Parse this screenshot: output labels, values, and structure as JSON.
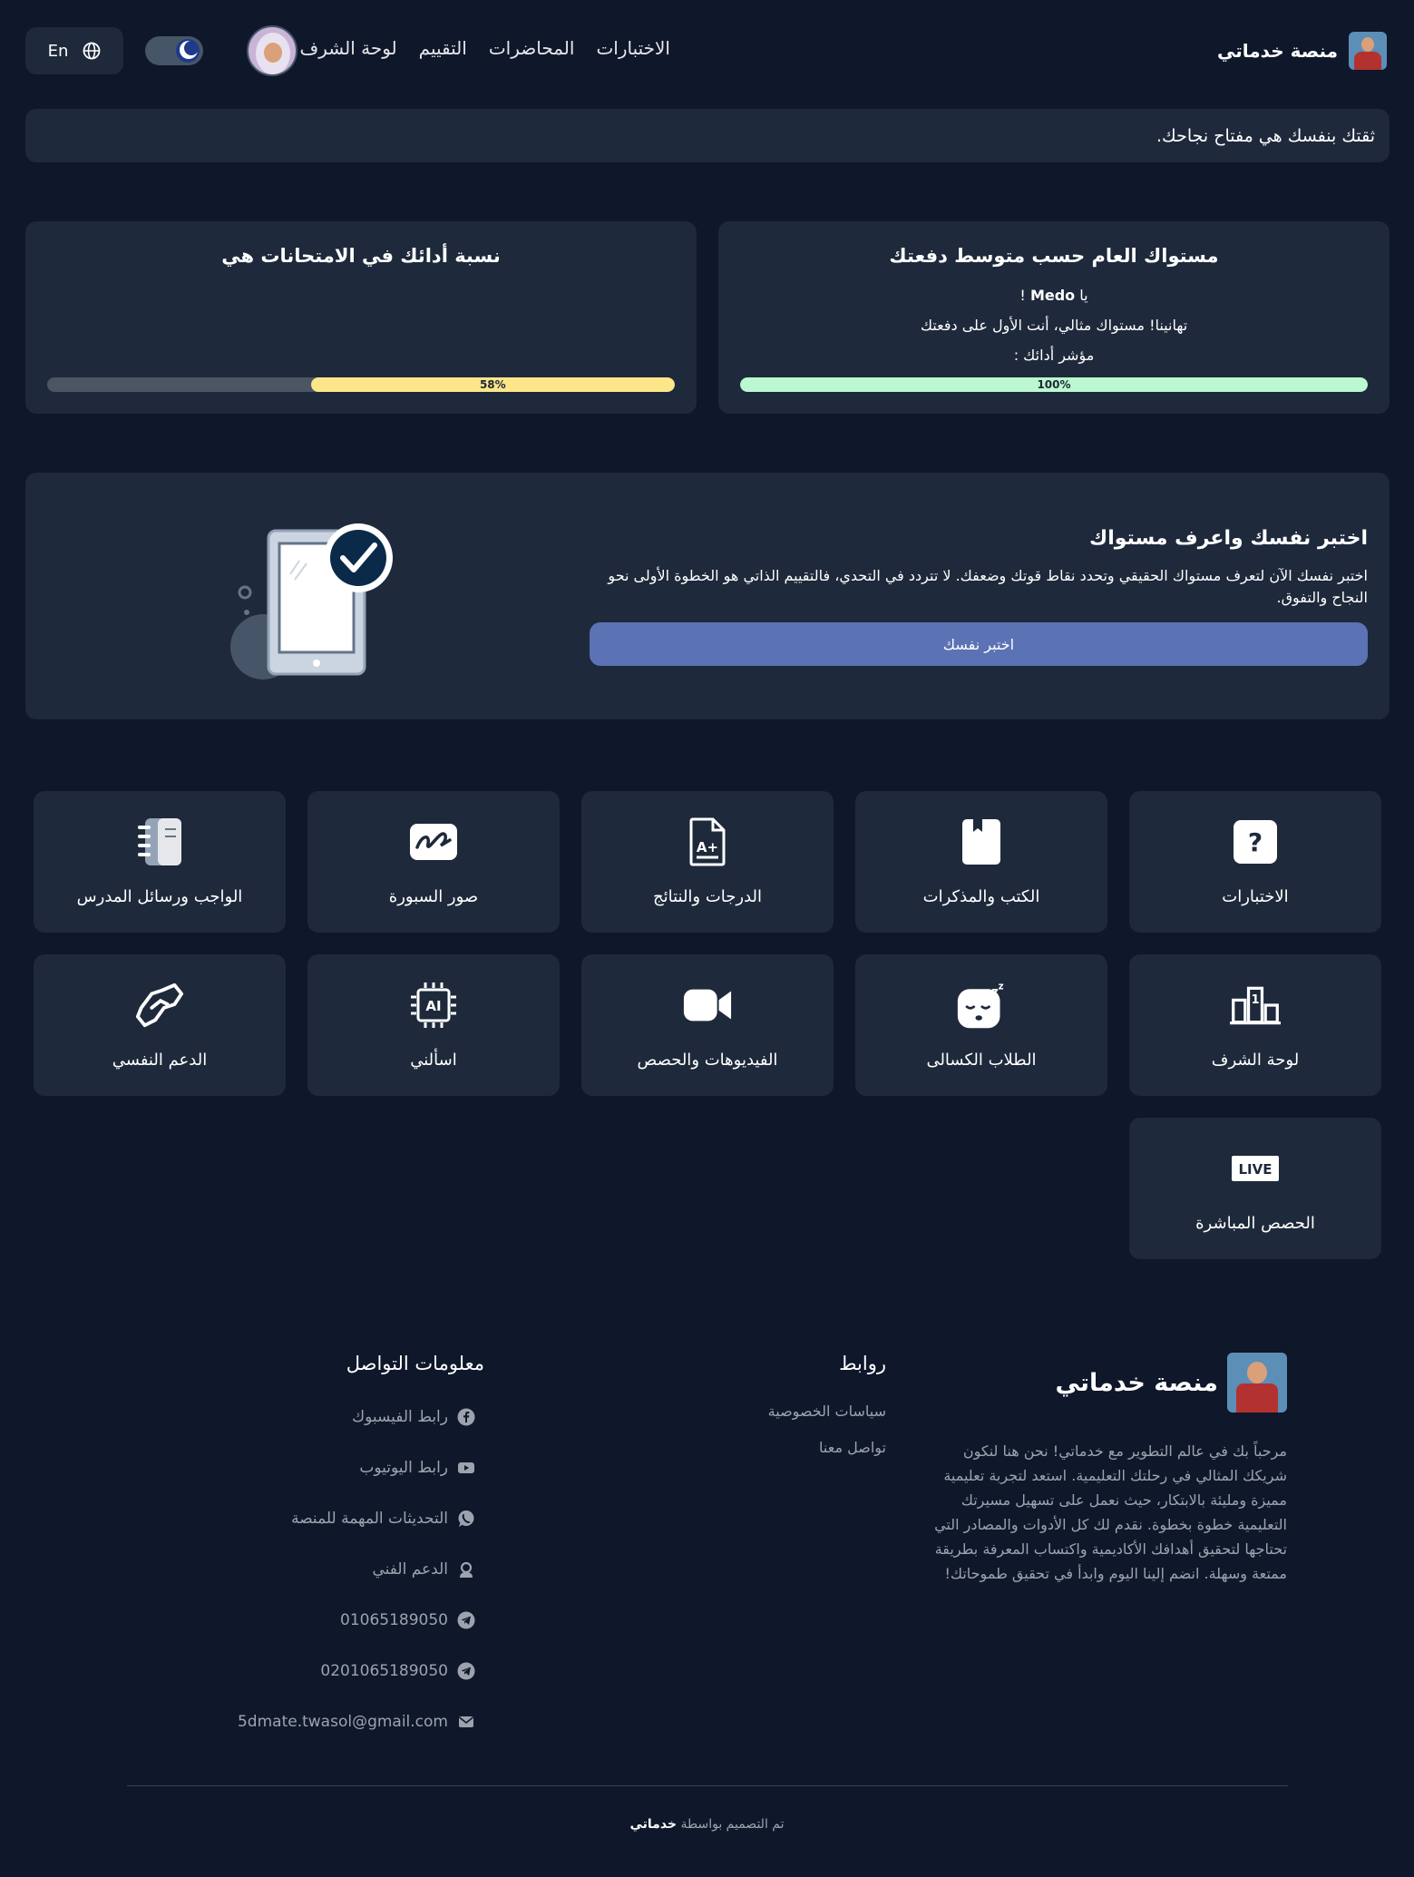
{
  "header": {
    "brand": "منصة خدماتي",
    "nav": [
      "الاختبارات",
      "المحاضرات",
      "التقييم",
      "لوحة الشرف"
    ],
    "lang_label": "En"
  },
  "quote": "ثقتك بنفسك هي مفتاح نجاحك.",
  "level_card": {
    "title": "مستواك العام حسب متوسط دفعتك",
    "greeting_prefix": "يا",
    "user_name": "Medo",
    "greeting_suffix": "!",
    "message": "تهانينا! مستواك مثالي، أنت الأول على دفعتك",
    "indicator_label": "مؤشر أدائك :",
    "progress_label": "100%",
    "progress": 1.0,
    "color": "#bbf7d0"
  },
  "exam_card": {
    "title": "نسبة أدائك في الامتحانات هي",
    "progress_label": "58%",
    "progress": 0.58,
    "color": "#fde68a"
  },
  "test_section": {
    "title": "اختبر نفسك واعرف مستواك",
    "description": "اختبر نفسك الآن لتعرف مستواك الحقيقي وتحدد نقاط قوتك وضعفك. لا تتردد في التحدي، فالتقييم الذاتي هو الخطوة الأولى نحو النجاح والتفوق.",
    "button": "اختبر نفسك"
  },
  "tiles": [
    {
      "label": "الاختبارات",
      "icon": "question-icon"
    },
    {
      "label": "الكتب والمذكرات",
      "icon": "book-icon"
    },
    {
      "label": "الدرجات والنتائج",
      "icon": "grade-file-icon"
    },
    {
      "label": "صور السبورة",
      "icon": "signature-icon"
    },
    {
      "label": "الواجب ورسائل المدرس",
      "icon": "notebook-icon"
    },
    {
      "label": "لوحة الشرف",
      "icon": "podium-icon"
    },
    {
      "label": "الطلاب الكسالى",
      "icon": "sleepy-face-icon"
    },
    {
      "label": "الفيديوهات والحصص",
      "icon": "video-icon"
    },
    {
      "label": "اسألني",
      "icon": "ai-chip-icon"
    },
    {
      "label": "الدعم النفسي",
      "icon": "handshake-icon"
    },
    {
      "label": "الحصص المباشرة",
      "icon": "live-icon"
    }
  ],
  "footer": {
    "brand": "منصة خدماتي",
    "description": "مرحباً بك في عالم التطوير مع خدماتي! نحن هنا لنكون شريكك المثالي في رحلتك التعليمية. استعد لتجربة تعليمية مميزة ومليئة بالابتكار، حيث نعمل على تسهيل مسيرتك التعليمية خطوة بخطوة. نقدم لك كل الأدوات والمصادر التي تحتاجها لتحقيق أهدافك الأكاديمية واكتساب المعرفة بطريقة ممتعة وسهلة. انضم إلينا اليوم وابدأ في تحقيق طموحاتك!",
    "links_title": "روابط",
    "links": [
      "سياسات الخصوصية",
      "تواصل معنا"
    ],
    "contact_title": "معلومات التواصل",
    "contacts": [
      {
        "text": "رابط الفيسبوك",
        "icon": "facebook-icon"
      },
      {
        "text": "رابط اليوتيوب",
        "icon": "youtube-icon"
      },
      {
        "text": "التحديثات المهمة للمنصة",
        "icon": "whatsapp-icon"
      },
      {
        "text": "الدعم الفني",
        "icon": "support-icon"
      },
      {
        "text": "01065189050",
        "icon": "telegram-icon"
      },
      {
        "text": "0201065189050",
        "icon": "telegram-icon"
      },
      {
        "text": "5dmate.twasol@gmail.com",
        "icon": "email-icon"
      }
    ],
    "credit_prefix": "تم التصميم بواسطة",
    "credit_brand": "خدماتي"
  }
}
